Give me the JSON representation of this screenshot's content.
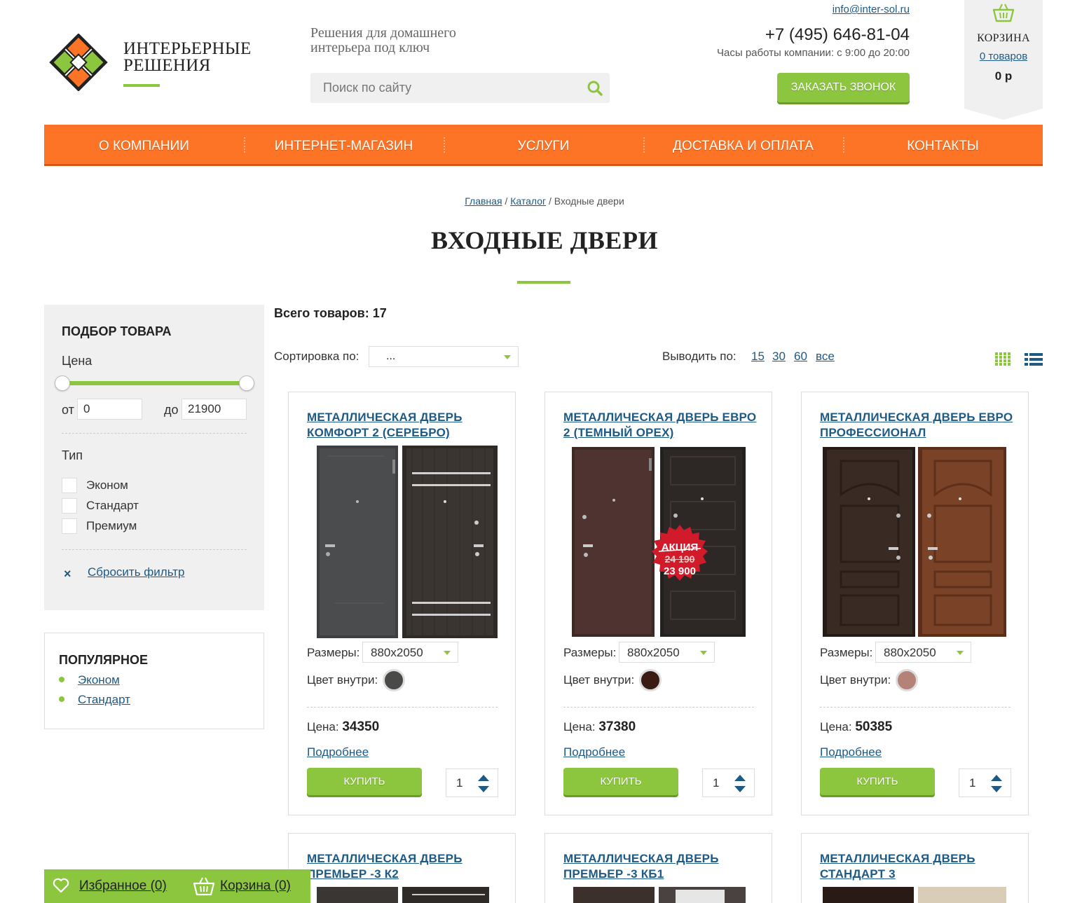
{
  "header": {
    "logo_line1": "ИНТЕРЬЕРНЫЕ",
    "logo_line2": "РЕШЕНИЯ",
    "tagline_line1": "Решения для домашнего",
    "tagline_line2": "интерьера под ключ",
    "search_placeholder": "Поиск по сайту",
    "email": "info@inter-sol.ru",
    "phone": "+7 (495) 646-81-04",
    "hours": "Часы работы компании: с 9:00 до 20:00",
    "callback_label": "ЗАКАЗАТЬ ЗВОНОК",
    "cart_title": "КОРЗИНА",
    "cart_count": "0 товаров",
    "cart_total": "0 р",
    "accent": "#8cc63f",
    "nav_color": "#fd7426"
  },
  "nav": [
    "О КОМПАНИИ",
    "ИНТЕРНЕТ-МАГАЗИН",
    "УСЛУГИ",
    "ДОСТАВКА И ОПЛАТА",
    "КОНТАКТЫ"
  ],
  "breadcrumbs": {
    "home": "Главная",
    "catalog": "Каталог",
    "current": "Входные двери",
    "separator": "/"
  },
  "page_title": "ВХОДНЫЕ ДВЕРИ",
  "filter": {
    "title": "ПОДБОР ТОВАРА",
    "price_label": "Цена",
    "from_label": "от",
    "to_label": "до",
    "price_from": "0",
    "price_to": "21900",
    "type_label": "Тип",
    "types": [
      "Эконом",
      "Стандарт",
      "Премиум"
    ],
    "reset_label": "Сбросить фильтр",
    "reset_icon": "×"
  },
  "popular": {
    "title": "ПОПУЛЯРНОЕ",
    "items": [
      "Эконом",
      "Стандарт"
    ]
  },
  "catalog": {
    "total": "Всего товаров: 17",
    "sort_label": "Сортировка по:",
    "sort_value": "...",
    "perpage_label": "Выводить по:",
    "perpage_options": [
      "15",
      "30",
      "60",
      "все"
    ]
  },
  "products": [
    {
      "title": "Металлическая дверь Комфорт 2 (Серебро)",
      "size_label": "Размеры:",
      "size": "880x2050",
      "color_label": "Цвет внутри:",
      "swatch": "#4a4a48",
      "price_label": "Цена:",
      "price": "34350",
      "more": "Подробнее",
      "buy": "КУПИТЬ",
      "qty": "1"
    },
    {
      "title": "Металлическая дверь Евро 2 (темный орех)",
      "size_label": "Размеры:",
      "size": "880x2050",
      "color_label": "Цвет внутри:",
      "swatch": "#3a1c14",
      "price_label": "Цена:",
      "price": "37380",
      "more": "Подробнее",
      "buy": "КУПИТЬ",
      "qty": "1",
      "promo": {
        "label": "АКЦИЯ",
        "old_price": "24 190",
        "new_price": "23 900"
      }
    },
    {
      "title": "Металлическая дверь Евро Профессионал",
      "size_label": "Размеры:",
      "size": "880x2050",
      "color_label": "Цвет внутри:",
      "swatch": "#b48276",
      "price_label": "Цена:",
      "price": "50385",
      "more": "Подробнее",
      "buy": "КУПИТЬ",
      "qty": "1"
    },
    {
      "title": "Металлическая дверь Премьер -3 К2"
    },
    {
      "title": "Металлическая дверь Премьер -3 КБ1"
    },
    {
      "title": "Металлическая дверь Стандарт 3"
    }
  ],
  "bottom_bar": {
    "favorites": "Избранное (0)",
    "cart": "Корзина (0)"
  }
}
